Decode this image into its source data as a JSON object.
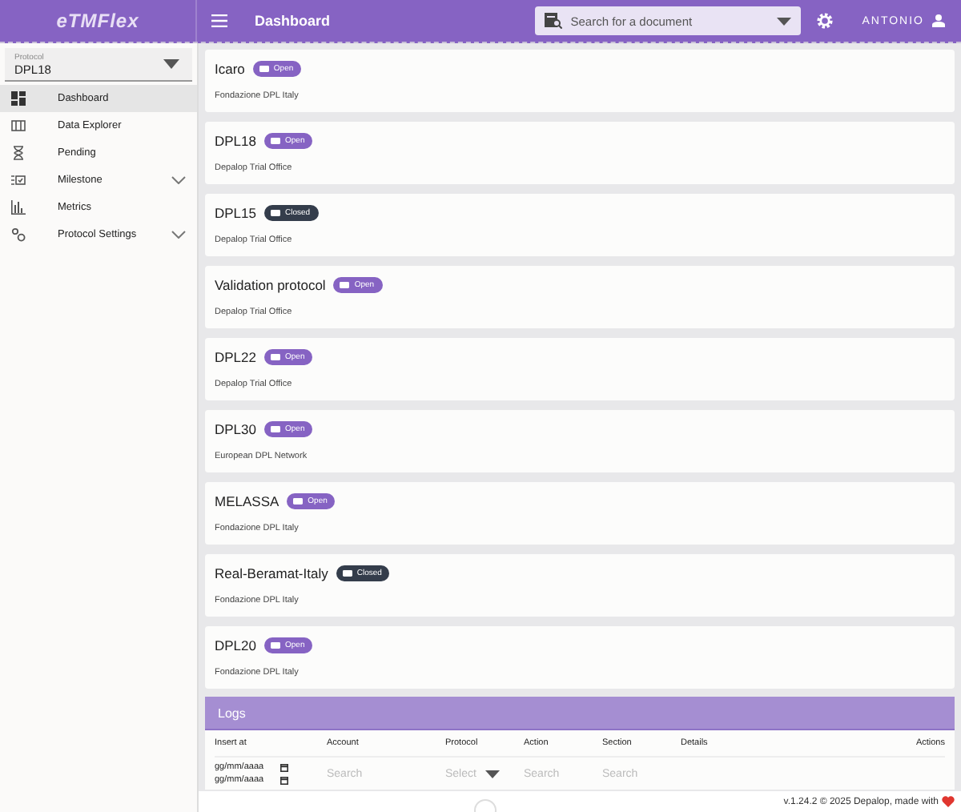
{
  "app": {
    "logo": "eTMFlex"
  },
  "header": {
    "title": "Dashboard",
    "search": {
      "placeholder": "Search for a document"
    },
    "user": "ANTONIO"
  },
  "protocol_select": {
    "label": "Protocol",
    "value": "DPL18"
  },
  "sidebar": {
    "items": [
      {
        "label": "Dashboard",
        "selected": true,
        "expandable": false
      },
      {
        "label": "Data Explorer",
        "selected": false,
        "expandable": false
      },
      {
        "label": "Pending",
        "selected": false,
        "expandable": false
      },
      {
        "label": "Milestone",
        "selected": false,
        "expandable": true
      },
      {
        "label": "Metrics",
        "selected": false,
        "expandable": false
      },
      {
        "label": "Protocol Settings",
        "selected": false,
        "expandable": true
      }
    ]
  },
  "protocols": [
    {
      "name": "Icaro",
      "closed": false,
      "status_label": "Open",
      "organization": "Fondazione DPL Italy"
    },
    {
      "name": "DPL18",
      "closed": false,
      "status_label": "Open",
      "organization": "Depalop Trial Office"
    },
    {
      "name": "DPL15",
      "closed": true,
      "status_label": "Closed",
      "organization": "Depalop Trial Office"
    },
    {
      "name": "Validation protocol",
      "closed": false,
      "status_label": "Open",
      "organization": "Depalop Trial Office"
    },
    {
      "name": "DPL22",
      "closed": false,
      "status_label": "Open",
      "organization": "Depalop Trial Office"
    },
    {
      "name": "DPL30",
      "closed": false,
      "status_label": "Open",
      "organization": "European DPL Network"
    },
    {
      "name": "MELASSA",
      "closed": false,
      "status_label": "Open",
      "organization": "Fondazione DPL Italy"
    },
    {
      "name": "Real-Beramat-Italy",
      "closed": true,
      "status_label": "Closed",
      "organization": "Fondazione DPL Italy"
    },
    {
      "name": "DPL20",
      "closed": false,
      "status_label": "Open",
      "organization": "Fondazione DPL Italy"
    }
  ],
  "logs": {
    "title": "Logs",
    "columns": [
      "Insert at",
      "Account",
      "Protocol",
      "Action",
      "Section",
      "Details",
      "Actions"
    ],
    "filters": {
      "date_from": "gg/mm/aaaa",
      "date_to": "gg/mm/aaaa",
      "account": {
        "placeholder": "Search"
      },
      "protocol": "Select",
      "action": {
        "placeholder": "Search"
      },
      "section": {
        "placeholder": "Search"
      }
    }
  },
  "footer": {
    "text": "v.1.24.2 © 2025 Depalop, made with"
  }
}
